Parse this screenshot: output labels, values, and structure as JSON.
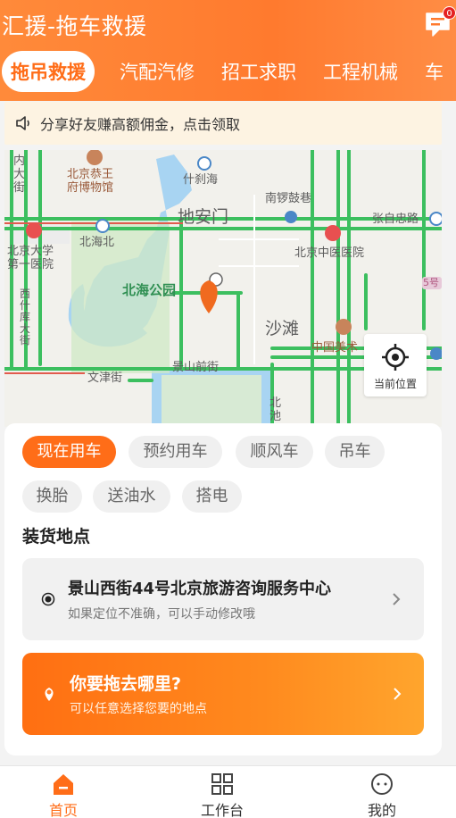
{
  "app": {
    "title": "汇援-拖车救援"
  },
  "header": {
    "message_badge": "0"
  },
  "tabs": [
    {
      "label": "拖吊救援",
      "active": true
    },
    {
      "label": "汽配汽修"
    },
    {
      "label": "招工求职"
    },
    {
      "label": "工程机械"
    },
    {
      "label": "车"
    }
  ],
  "notice": {
    "text": "分享好友赚高额佣金，点击领取"
  },
  "map": {
    "labels": {
      "l1": "内\n大\n街",
      "l2": "北京恭王\n府博物馆",
      "l3": "什刹海",
      "l4": "南锣鼓巷",
      "l5": "地安门",
      "l6": "张自忠路",
      "l7": "北京大学\n第一医院",
      "l8": "北海北",
      "l9": "北京中医医院",
      "l10": "北海公园",
      "l11": "西\n什\n库\n大\n街",
      "l12": "沙滩",
      "l13": "中国美术",
      "l14": "文津街",
      "l15": "景山前街",
      "l16": "北\n池",
      "l17": "5号"
    },
    "locate_label": "当前位置"
  },
  "service_types": [
    "现在用车",
    "预约用车",
    "顺风车",
    "吊车",
    "换胎",
    "送油水",
    "搭电"
  ],
  "pickup": {
    "section_title": "装货地点",
    "address": "景山西街44号北京旅游咨询服务中心",
    "hint": "如果定位不准确，可以手动修改哦"
  },
  "destination": {
    "title": "你要拖去哪里?",
    "hint": "可以任意选择您要的地点"
  },
  "bottom_nav": [
    {
      "label": "首页",
      "icon": "home-icon",
      "active": true
    },
    {
      "label": "工作台",
      "icon": "grid-icon"
    },
    {
      "label": "我的",
      "icon": "profile-icon"
    }
  ],
  "colors": {
    "accent": "#ff6d18",
    "header": "#ff7a2e",
    "map_road": "#3cbf5f",
    "map_water": "#a8d4f2"
  }
}
